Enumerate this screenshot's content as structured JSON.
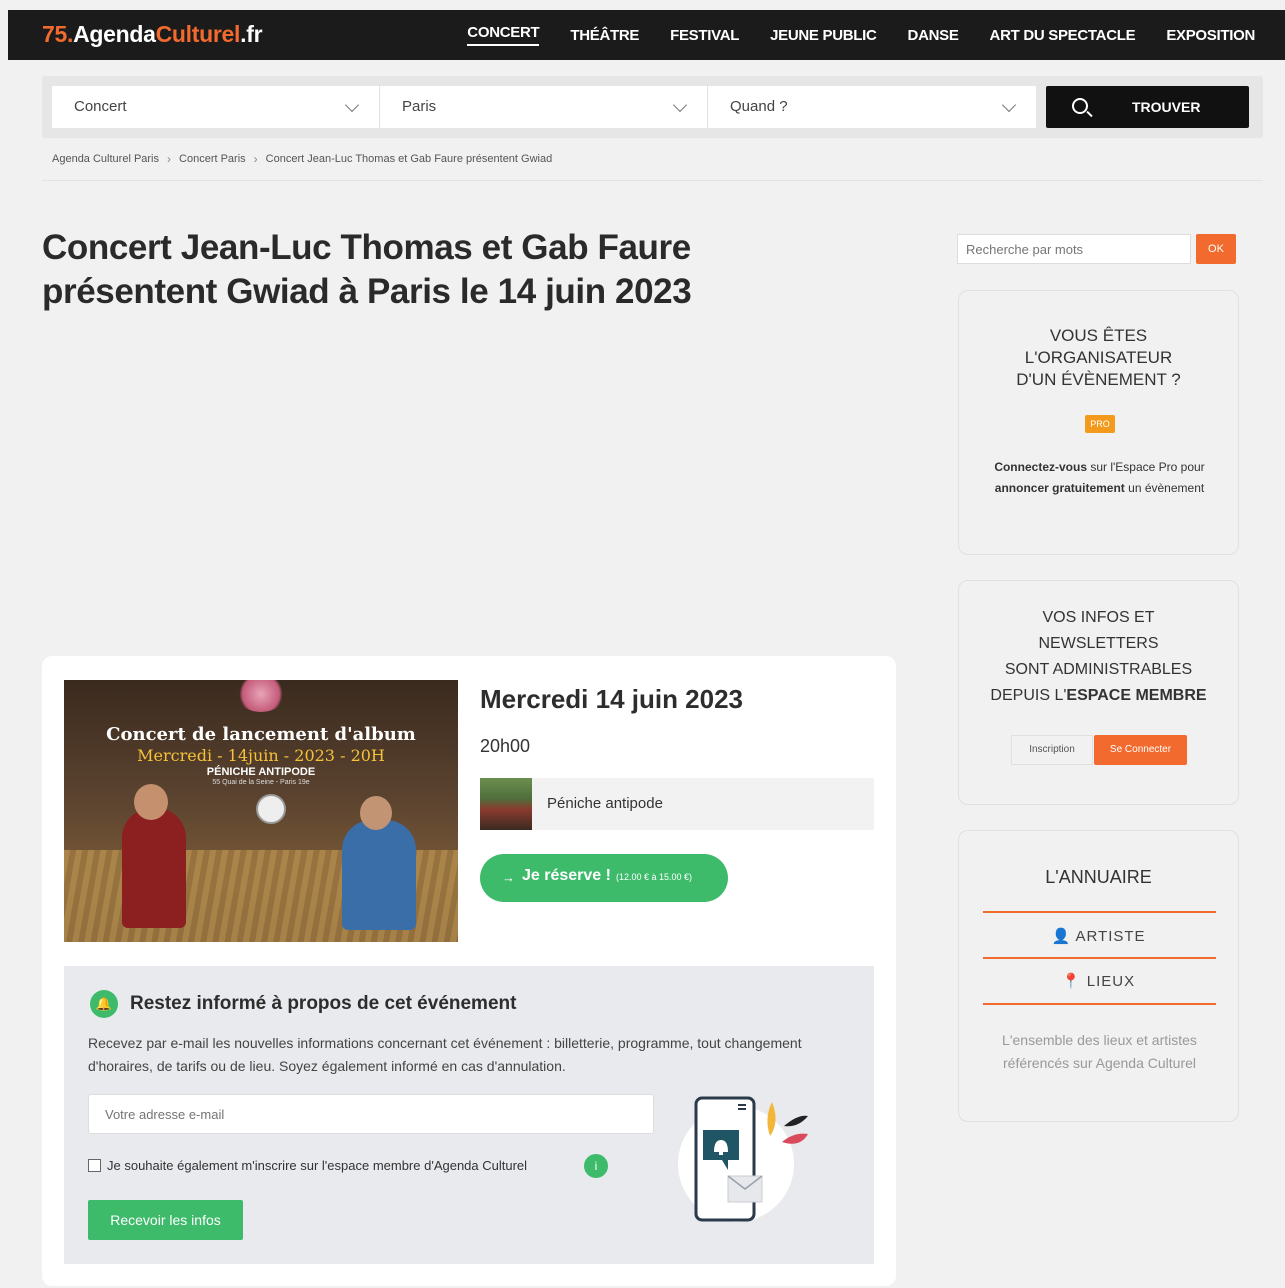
{
  "logo": {
    "prefix": "75.",
    "mid": "Agenda",
    "end": "Culturel",
    "tld": ".fr"
  },
  "nav": [
    "CONCERT",
    "THÉÂTRE",
    "FESTIVAL",
    "JEUNE PUBLIC",
    "DANSE",
    "ART DU SPECTACLE",
    "EXPOSITION"
  ],
  "search": {
    "category": "Concert",
    "city": "Paris",
    "when": "Quand ?",
    "button": "TROUVER"
  },
  "breadcrumb": [
    "Agenda Culturel Paris",
    "Concert Paris",
    "Concert Jean-Luc Thomas et Gab Faure présentent Gwiad"
  ],
  "title": "Concert Jean-Luc Thomas et Gab Faure présentent Gwiad à Paris le 14 juin 2023",
  "poster": {
    "l1": "Concert de lancement d'album",
    "l2": "Mercredi - 14juin - 2023 - 20H",
    "l3": "PÉNICHE ANTIPODE",
    "l4": "55 Quai de la Seine - Paris 19e"
  },
  "event": {
    "date": "Mercredi 14 juin 2023",
    "time": "20h00",
    "venue": "Péniche antipode",
    "reserve_label": "Je réserve !",
    "reserve_price": "(12.00 € à 15.00 €)"
  },
  "inform": {
    "title": "Restez informé à propos de cet événement",
    "desc": "Recevez par e-mail les nouvelles informations concernant cet événement : billetterie, programme, tout changement d'horaires, de tarifs ou de lieu. Soyez également informé en cas d'annulation.",
    "email_placeholder": "Votre adresse e-mail",
    "checkbox_label": "Je souhaite également m'inscrire sur l'espace membre d'Agenda Culturel",
    "submit": "Recevoir les infos"
  },
  "sidebar": {
    "keyword_placeholder": "Recherche par mots",
    "ok": "OK",
    "org": {
      "l1": "VOUS ÊTES",
      "l2": "L'ORGANISATEUR",
      "l3": "D'UN ÉVÈNEMENT ?",
      "badge": "PRO",
      "b1": "Connectez-vous",
      "t1": " sur l'Espace Pro pour ",
      "b2": "annoncer gratuitement",
      "t2": " un évènement"
    },
    "member": {
      "l1": "VOS INFOS ET",
      "l2": "NEWSLETTERS",
      "l3": "SONT ADMINISTRABLES",
      "l4a": "DEPUIS L'",
      "l4b": "ESPACE MEMBRE",
      "inscription": "Inscription",
      "connect": "Se Connecter"
    },
    "annuaire": {
      "title": "L'ANNUAIRE",
      "artiste": "ARTISTE",
      "lieux": "LIEUX",
      "desc": "L'ensemble des lieux et artistes référencés sur Agenda Culturel"
    }
  }
}
